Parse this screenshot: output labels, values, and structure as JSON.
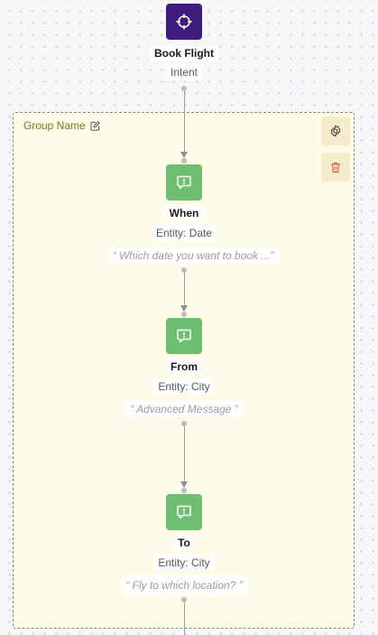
{
  "intent": {
    "title": "Book Flight",
    "subtitle": "Intent"
  },
  "group": {
    "name": "Group Name"
  },
  "nodes": [
    {
      "title": "When",
      "entity": "Entity: Date",
      "message": "“ Which date you want to book ...”"
    },
    {
      "title": "From",
      "entity": "Entity: City",
      "message": "“ Advanced Message ”"
    },
    {
      "title": "To",
      "entity": "Entity: City",
      "message": "“ Fly to which location? ”"
    }
  ],
  "colors": {
    "intent": "#3f1b7e",
    "message": "#6fbf73",
    "group_bg": "#fefbe9",
    "group_label": "#8a7220",
    "delete": "#e05a55"
  }
}
